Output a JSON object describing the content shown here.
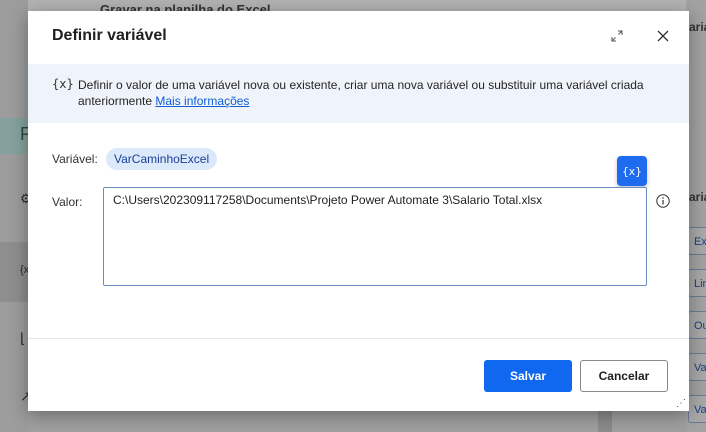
{
  "background": {
    "top_text": "Gravar na planilha do Excel",
    "left_letter": "F",
    "left_icon_text": "{x",
    "right_heading": "aria",
    "right_heading_2": "aria",
    "right_items": [
      "Ex",
      "Lin",
      "Ou",
      "Va",
      "Va"
    ]
  },
  "dialog": {
    "title": "Definir variável",
    "info": {
      "icon_text": "{x}",
      "text": "Definir o valor de uma variável nova ou existente, criar uma nova variável ou substituir uma variável criada anteriormente",
      "link": "Mais informações"
    },
    "variable_label": "Variável:",
    "variable_name": "VarCaminhoExcel",
    "value_label": "Valor:",
    "value": "C:\\Users\\202309117258\\Documents\\Projeto Power Automate 3\\Salario Total.xlsx",
    "var_picker_text": "{x}",
    "save_label": "Salvar",
    "cancel_label": "Cancelar"
  },
  "colors": {
    "primary": "#1168f0",
    "info_band": "#eff4fb",
    "chip_bg": "#dce9fb"
  }
}
